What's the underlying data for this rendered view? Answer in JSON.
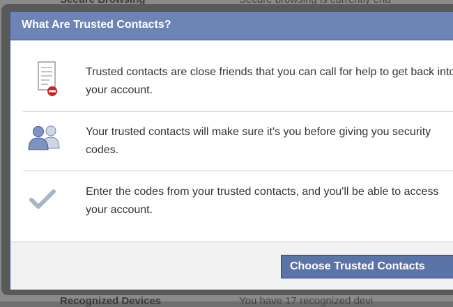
{
  "background": {
    "top_left": "Secure Browsing",
    "top_right": "Secure browsing is currently ena",
    "bottom_left": "Recognized Devices",
    "bottom_right": "You have 17 recognized devi"
  },
  "dialog": {
    "title": "What Are Trusted Contacts?",
    "rows": [
      {
        "icon": "document-icon",
        "text": "Trusted contacts are close friends that you can call for help to get back into your account."
      },
      {
        "icon": "people-icon",
        "text": "Your trusted contacts will make sure it's you before giving you security codes."
      },
      {
        "icon": "checkmark-icon",
        "text": "Enter the codes from your trusted contacts, and you'll be able to access your account."
      }
    ],
    "button_label": "Choose Trusted Contacts"
  },
  "colors": {
    "header": "#6d84b4",
    "button": "#5b74a8",
    "border": "#3b5998"
  }
}
